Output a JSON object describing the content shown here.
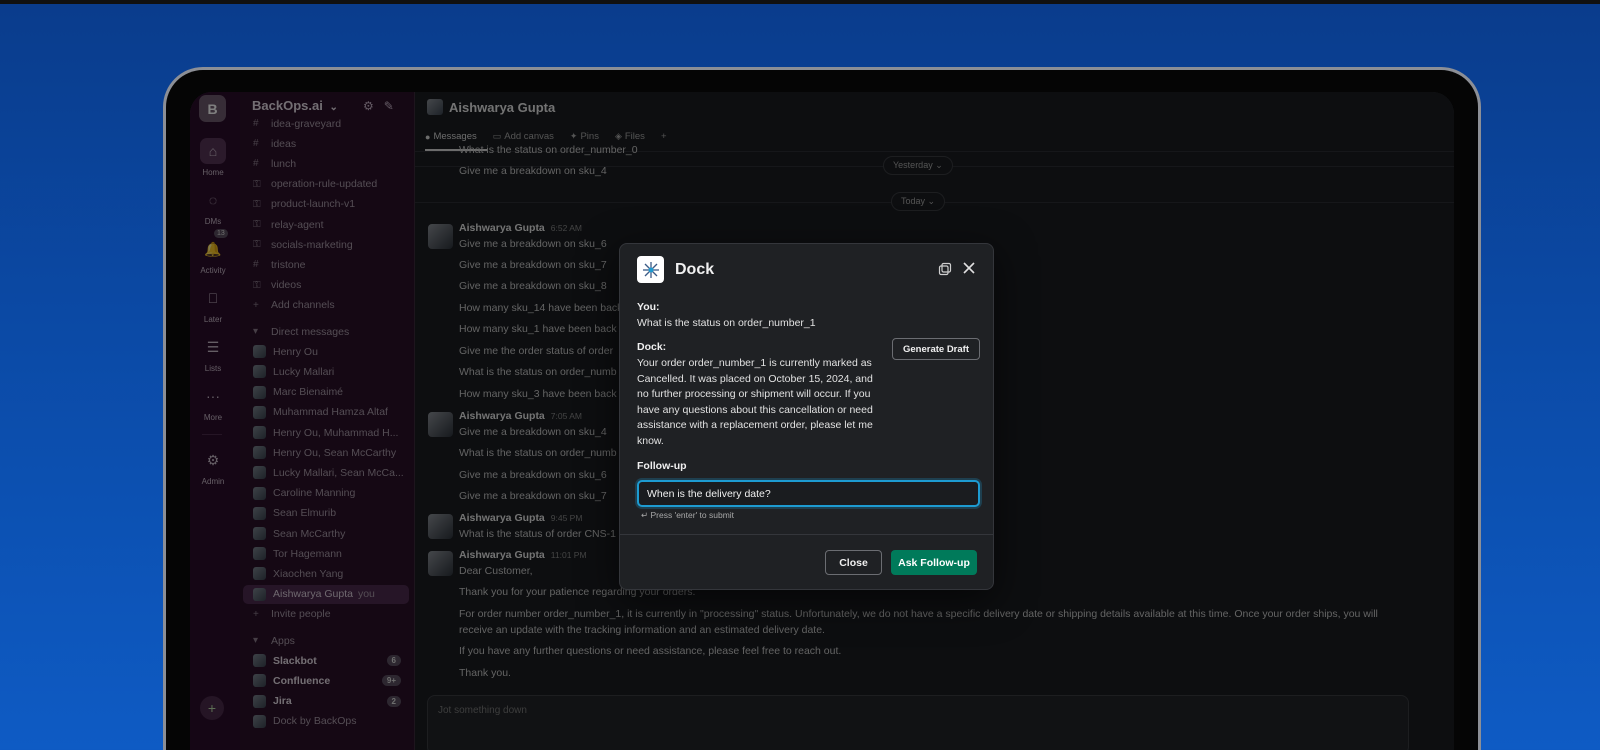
{
  "workspace": {
    "initial": "B",
    "name": "BackOps.ai",
    "chevron": "⌄"
  },
  "rail": {
    "items": [
      {
        "label": "Home",
        "icon": "home-icon"
      },
      {
        "label": "DMs",
        "icon": "dms-icon"
      },
      {
        "label": "Activity",
        "icon": "bell-icon",
        "badge": "13"
      },
      {
        "label": "Later",
        "icon": "bookmark-icon"
      },
      {
        "label": "Lists",
        "icon": "lists-icon"
      },
      {
        "label": "More",
        "icon": "more-icon"
      },
      {
        "label": "Admin",
        "icon": "gear-icon"
      }
    ]
  },
  "sidebar": {
    "channels": [
      {
        "prefix": "#",
        "label": "idea-graveyard"
      },
      {
        "prefix": "#",
        "label": "ideas"
      },
      {
        "prefix": "#",
        "label": "lunch"
      },
      {
        "prefix": "🔒",
        "label": "operation-rule-updated"
      },
      {
        "prefix": "🔒",
        "label": "product-launch-v1"
      },
      {
        "prefix": "🔒",
        "label": "relay-agent"
      },
      {
        "prefix": "🔒",
        "label": "socials-marketing"
      },
      {
        "prefix": "#",
        "label": "tristone"
      },
      {
        "prefix": "🔒",
        "label": "videos"
      },
      {
        "prefix": "+",
        "label": "Add channels"
      }
    ],
    "dm_section": "Direct messages",
    "dms": [
      "Henry Ou",
      "Lucky Mallari",
      "Marc Bienaimé",
      "Muhammad Hamza Altaf",
      "Henry Ou, Muhammad H...",
      "Henry Ou, Sean McCarthy",
      "Lucky Mallari, Sean McCa...",
      "Caroline Manning",
      "Sean Elmurib",
      "Sean McCarthy",
      "Tor Hagemann",
      "Xiaochen Yang"
    ],
    "self": {
      "name": "Aishwarya Gupta",
      "suffix": "you"
    },
    "invite": "Invite people",
    "apps_section": "Apps",
    "apps": [
      {
        "label": "Slackbot",
        "badge": "6",
        "bold": true
      },
      {
        "label": "Confluence",
        "badge": "9+",
        "bold": true
      },
      {
        "label": "Jira",
        "badge": "2",
        "bold": true
      },
      {
        "label": "Dock by BackOps",
        "badge": "",
        "bold": false
      }
    ]
  },
  "main": {
    "header": "Aishwarya Gupta",
    "tabs": [
      {
        "label": "Messages",
        "icon": "chat-icon"
      },
      {
        "label": "Add canvas",
        "icon": "canvas-icon"
      },
      {
        "label": "Pins",
        "icon": "pin-icon"
      },
      {
        "label": "Files",
        "icon": "files-icon"
      },
      {
        "label": "+",
        "icon": "plus-icon"
      }
    ],
    "day_yesterday": "Yesterday ⌄",
    "day_today": "Today ⌄",
    "lines": {
      "l0": "What is the status on order_number_0",
      "l1": "Give me a breakdown on sku_4",
      "h1_name": "Aishwarya Gupta",
      "h1_time": "6:52 AM",
      "l2": "Give me a breakdown on sku_6",
      "l3": "Give me a breakdown on sku_7",
      "l4": "Give me a breakdown on sku_8",
      "l5": "How many sku_14 have been back",
      "l6": "How many sku_1 have been back",
      "l7": "Give me the order status of order",
      "l8": "What is the status on order_numb",
      "l9": "How many sku_3 have been back",
      "h2_name": "Aishwarya Gupta",
      "h2_time": "7:05 AM",
      "l10": "Give me a breakdown on sku_4",
      "l11": "What is the status on order_numb",
      "l12": "Give me a breakdown on sku_6",
      "l13": "Give me a breakdown on sku_7",
      "h3_name": "Aishwarya Gupta",
      "h3_time": "9:45 PM",
      "l14": "What is the status of order CNS-1",
      "h4_name": "Aishwarya Gupta",
      "h4_time": "11:01 PM",
      "l15": "Dear Customer,",
      "l16": "Thank you for your patience regarding your orders.",
      "l17": "For order number order_number_1, it is currently in \"processing\" status. Unfortunately, we do not have a specific delivery date or shipping details available at this time. Once your order ships, you will",
      "l18": "receive an update with the tracking information and an estimated delivery date.",
      "l19": "If you have any further questions or need assistance, please feel free to reach out.",
      "l20": "Thank you."
    },
    "composer_placeholder": "Jot something down"
  },
  "modal": {
    "title": "Dock",
    "you_label": "You:",
    "you_text": "What is the status on order_number_1",
    "dock_label": "Dock:",
    "dock_text": "Your order order_number_1 is currently marked as Cancelled. It was placed on October 15, 2024, and no further processing or shipment will occur. If you have any questions about this cancellation or need assistance with a replacement order, please let me know.",
    "generate_draft": "Generate Draft",
    "followup_label": "Follow-up",
    "followup_value": "When is the delivery date?",
    "hint": "↵ Press 'enter' to submit",
    "close": "Close",
    "ask": "Ask Follow-up"
  },
  "colors": {
    "background": "#0b4aa6",
    "sidebar": "#2a1129",
    "modal": "#1f2124",
    "primary_button": "#007a5a",
    "focus_ring": "#1d9bd1"
  }
}
